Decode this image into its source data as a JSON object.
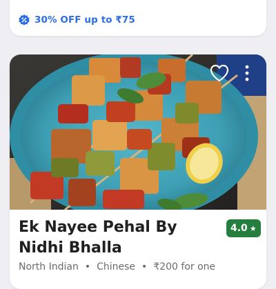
{
  "offer": {
    "text": "30% OFF up to ₹75",
    "icon": "discount-badge-icon",
    "color": "#2b6ee6"
  },
  "restaurant": {
    "name": "Ek Nayee Pehal By Nidhi Bhalla",
    "rating": "4.0",
    "rating_icon": "star-icon",
    "rating_color": "#257e3e",
    "cuisines": [
      "North Indian",
      "Chinese"
    ],
    "price": "₹200 for one",
    "separator": "•",
    "image_alt": "paneer-tikka-skewers-icon",
    "favorite_icon": "heart-icon",
    "more_icon": "more-vertical-icon"
  }
}
